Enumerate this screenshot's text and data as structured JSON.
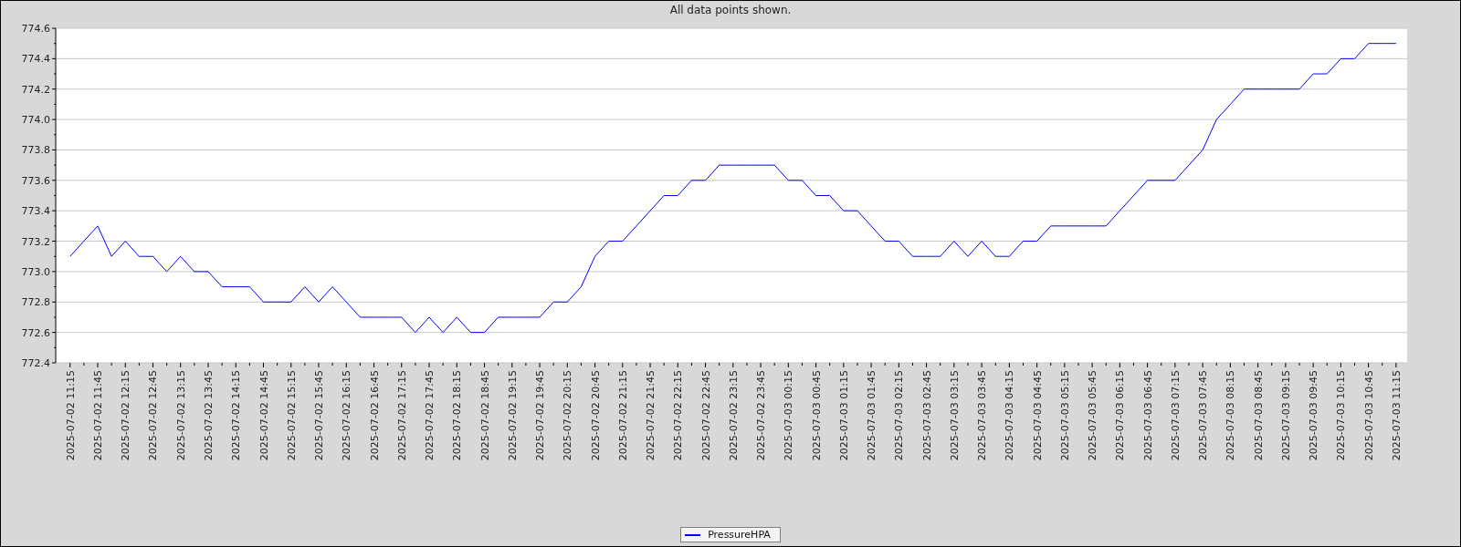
{
  "chart_data": {
    "type": "line",
    "title": "All data points shown.",
    "grid": true,
    "ylim": [
      772.4,
      774.6
    ],
    "yticks": [
      {
        "value": 772.4,
        "label": "772.4"
      },
      {
        "value": 772.6,
        "label": "772.6"
      },
      {
        "value": 772.8,
        "label": "772.8"
      },
      {
        "value": 773,
        "label": "773.0"
      },
      {
        "value": 773.2,
        "label": "773.2"
      },
      {
        "value": 773.4,
        "label": "773.4"
      },
      {
        "value": 773.6,
        "label": "773.6"
      },
      {
        "value": 773.8,
        "label": "773.8"
      },
      {
        "value": 774,
        "label": "774.0"
      },
      {
        "value": 774.2,
        "label": "774.2"
      },
      {
        "value": 774.4,
        "label": "774.4"
      },
      {
        "value": 774.6,
        "label": "774.6"
      }
    ],
    "categories": [
      "2025-07-02 11:15",
      null,
      "2025-07-02 11:45",
      null,
      "2025-07-02 12:15",
      null,
      "2025-07-02 12:45",
      null,
      "2025-07-02 13:15",
      null,
      "2025-07-02 13:45",
      null,
      "2025-07-02 14:15",
      null,
      "2025-07-02 14:45",
      null,
      "2025-07-02 15:15",
      null,
      "2025-07-02 15:45",
      null,
      "2025-07-02 16:15",
      null,
      "2025-07-02 16:45",
      null,
      "2025-07-02 17:15",
      null,
      "2025-07-02 17:45",
      null,
      "2025-07-02 18:15",
      null,
      "2025-07-02 18:45",
      null,
      "2025-07-02 19:15",
      null,
      "2025-07-02 19:45",
      null,
      "2025-07-02 20:15",
      null,
      "2025-07-02 20:45",
      null,
      "2025-07-02 21:15",
      null,
      "2025-07-02 21:45",
      null,
      "2025-07-02 22:15",
      null,
      "2025-07-02 22:45",
      null,
      "2025-07-02 23:15",
      null,
      "2025-07-02 23:45",
      null,
      "2025-07-03 00:15",
      null,
      "2025-07-03 00:45",
      null,
      "2025-07-03 01:15",
      null,
      "2025-07-03 01:45",
      null,
      "2025-07-03 02:15",
      null,
      "2025-07-03 02:45",
      null,
      "2025-07-03 03:15",
      null,
      "2025-07-03 03:45",
      null,
      "2025-07-03 04:15",
      null,
      "2025-07-03 04:45",
      null,
      "2025-07-03 05:15",
      null,
      "2025-07-03 05:45",
      null,
      "2025-07-03 06:15",
      null,
      "2025-07-03 06:45",
      null,
      "2025-07-03 07:15",
      null,
      "2025-07-03 07:45",
      null,
      "2025-07-03 08:15",
      null,
      "2025-07-03 08:45",
      null,
      "2025-07-03 09:15",
      null,
      "2025-07-03 09:45",
      null,
      "2025-07-03 10:15",
      null,
      "2025-07-03 10:45",
      null,
      "2025-07-03 11:15"
    ],
    "series": [
      {
        "name": "PressureHPA",
        "color": "#0000ff",
        "values": [
          773.1,
          773.2,
          773.3,
          773.1,
          773.2,
          773.1,
          773.1,
          773.0,
          773.1,
          773.0,
          773.0,
          772.9,
          772.9,
          772.9,
          772.8,
          772.8,
          772.8,
          772.9,
          772.8,
          772.9,
          772.8,
          772.7,
          772.7,
          772.7,
          772.7,
          772.6,
          772.7,
          772.6,
          772.7,
          772.6,
          772.6,
          772.7,
          772.7,
          772.7,
          772.7,
          772.8,
          772.8,
          772.9,
          773.1,
          773.2,
          773.2,
          773.3,
          773.4,
          773.5,
          773.5,
          773.6,
          773.6,
          773.7,
          773.7,
          773.7,
          773.7,
          773.7,
          773.6,
          773.6,
          773.5,
          773.5,
          773.4,
          773.4,
          773.3,
          773.2,
          773.2,
          773.1,
          773.1,
          773.1,
          773.2,
          773.1,
          773.2,
          773.1,
          773.1,
          773.2,
          773.2,
          773.3,
          773.3,
          773.3,
          773.3,
          773.3,
          773.4,
          773.5,
          773.6,
          773.6,
          773.6,
          773.7,
          773.8,
          774.0,
          774.1,
          774.2,
          774.2,
          774.2,
          774.2,
          774.2,
          774.3,
          774.3,
          774.4,
          774.4,
          774.5,
          774.5,
          774.5
        ]
      }
    ]
  }
}
